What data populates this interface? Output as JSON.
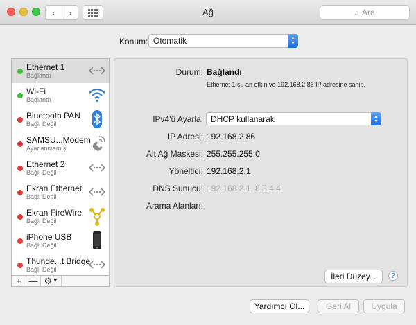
{
  "window": {
    "title": "Ağ"
  },
  "search": {
    "placeholder": "Ara"
  },
  "location": {
    "label": "Konum:",
    "value": "Otomatik"
  },
  "services": [
    {
      "name": "Ethernet 1",
      "status": "Bağlandı",
      "dot_color": "#3fbf3f",
      "icon": "ethernet-icon",
      "selected": true
    },
    {
      "name": "Wi-Fi",
      "status": "Bağlandı",
      "dot_color": "#3fbf3f",
      "icon": "wifi-icon",
      "selected": false
    },
    {
      "name": "Bluetooth PAN",
      "status": "Bağlı Değil",
      "dot_color": "#e0413a",
      "icon": "bluetooth-icon",
      "selected": false
    },
    {
      "name": "SAMSU...Modem",
      "status": "Ayarlanmamış",
      "dot_color": "#e0413a",
      "icon": "modem-icon",
      "selected": false
    },
    {
      "name": "Ethernet 2",
      "status": "Bağlı Değil",
      "dot_color": "#e0413a",
      "icon": "ethernet-icon",
      "selected": false
    },
    {
      "name": "Ekran Ethernet",
      "status": "Bağlı Değil",
      "dot_color": "#e0413a",
      "icon": "ethernet-icon",
      "selected": false
    },
    {
      "name": "Ekran FireWire",
      "status": "Bağlı Değil",
      "dot_color": "#e0413a",
      "icon": "firewire-icon",
      "selected": false
    },
    {
      "name": "iPhone USB",
      "status": "Bağlı Değil",
      "dot_color": "#e0413a",
      "icon": "iphone-icon",
      "selected": false
    },
    {
      "name": "Thunde...t Bridge",
      "status": "Bağlı Değil",
      "dot_color": "#e0413a",
      "icon": "ethernet-icon",
      "selected": false
    }
  ],
  "sidebar_actions": {
    "add": "+",
    "remove": "—",
    "gear": "⚙"
  },
  "detail": {
    "status_label": "Durum:",
    "status_value": "Bağlandı",
    "status_desc": "Ethernet 1 şu an etkin ve 192.168.2.86 IP adresine sahip.",
    "ipv4_label": "IPv4'ü Ayarla:",
    "ipv4_value": "DHCP kullanarak",
    "ip_label": "IP Adresi:",
    "ip_value": "192.168.2.86",
    "mask_label": "Alt Ağ Maskesi:",
    "mask_value": "255.255.255.0",
    "router_label": "Yönelticı:",
    "router_value": "192.168.2.1",
    "dns_label": "DNS Sunucu:",
    "dns_value": "192.168.2.1, 8.8.4.4",
    "search_domains_label": "Arama Alanları:"
  },
  "buttons": {
    "advanced": "İleri Düzey...",
    "help": "?",
    "assist": "Yardımcı Ol...",
    "revert": "Geri Al",
    "apply": "Uygula"
  }
}
